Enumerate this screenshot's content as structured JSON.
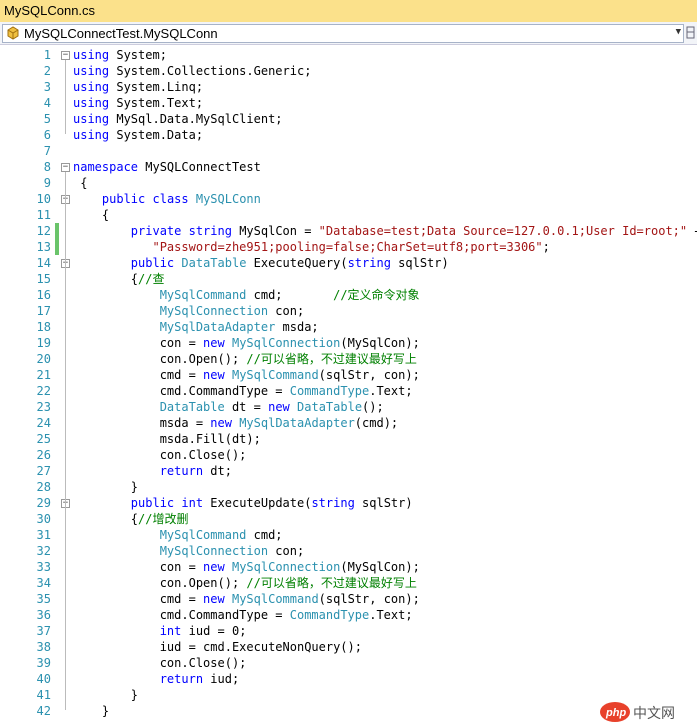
{
  "tab": {
    "title": "MySQLConn.cs"
  },
  "nav": {
    "member": "MySQLConnectTest.MySQLConn"
  },
  "watermark": {
    "text": "php 中文网"
  },
  "colors": {
    "keyword": "#0000ff",
    "type": "#2b91af",
    "string": "#a31515",
    "comment": "#008000"
  },
  "lines": [
    {
      "n": "1",
      "tokens": [
        [
          "k",
          "using"
        ],
        [
          "p",
          " System;"
        ]
      ]
    },
    {
      "n": "2",
      "tokens": [
        [
          "k",
          "using"
        ],
        [
          "p",
          " System.Collections.Generic;"
        ]
      ]
    },
    {
      "n": "3",
      "tokens": [
        [
          "k",
          "using"
        ],
        [
          "p",
          " System.Linq;"
        ]
      ]
    },
    {
      "n": "4",
      "tokens": [
        [
          "k",
          "using"
        ],
        [
          "p",
          " System.Text;"
        ]
      ]
    },
    {
      "n": "5",
      "tokens": [
        [
          "k",
          "using"
        ],
        [
          "p",
          " MySql.Data.MySqlClient;"
        ]
      ]
    },
    {
      "n": "6",
      "tokens": [
        [
          "k",
          "using"
        ],
        [
          "p",
          " System.Data;"
        ]
      ]
    },
    {
      "n": "7",
      "tokens": []
    },
    {
      "n": "8",
      "tokens": [
        [
          "k",
          "namespace"
        ],
        [
          "p",
          " MySQLConnectTest"
        ]
      ]
    },
    {
      "n": "9",
      "tokens": [
        [
          "p",
          " {"
        ]
      ]
    },
    {
      "n": "10",
      "tokens": [
        [
          "p",
          "    "
        ],
        [
          "k",
          "public"
        ],
        [
          "p",
          " "
        ],
        [
          "k",
          "class"
        ],
        [
          "p",
          " "
        ],
        [
          "t",
          "MySQLConn"
        ]
      ]
    },
    {
      "n": "11",
      "tokens": [
        [
          "p",
          "    {"
        ]
      ]
    },
    {
      "n": "12",
      "tokens": [
        [
          "p",
          "        "
        ],
        [
          "k",
          "private"
        ],
        [
          "p",
          " "
        ],
        [
          "k",
          "string"
        ],
        [
          "p",
          " MySqlCon = "
        ],
        [
          "s",
          "\"Database=test;Data Source=127.0.0.1;User Id=root;\""
        ],
        [
          "p",
          " +"
        ]
      ]
    },
    {
      "n": "13",
      "tokens": [
        [
          "p",
          "           "
        ],
        [
          "s",
          "\"Password=zhe951;pooling=false;CharSet=utf8;port=3306\""
        ],
        [
          "p",
          ";"
        ]
      ]
    },
    {
      "n": "14",
      "tokens": [
        [
          "p",
          "        "
        ],
        [
          "k",
          "public"
        ],
        [
          "p",
          " "
        ],
        [
          "t",
          "DataTable"
        ],
        [
          "p",
          " ExecuteQuery("
        ],
        [
          "k",
          "string"
        ],
        [
          "p",
          " sqlStr)"
        ]
      ]
    },
    {
      "n": "15",
      "tokens": [
        [
          "p",
          "        {"
        ],
        [
          "c",
          "//查"
        ]
      ]
    },
    {
      "n": "16",
      "tokens": [
        [
          "p",
          "            "
        ],
        [
          "t",
          "MySqlCommand"
        ],
        [
          "p",
          " cmd;       "
        ],
        [
          "c",
          "//定义命令对象"
        ]
      ]
    },
    {
      "n": "17",
      "tokens": [
        [
          "p",
          "            "
        ],
        [
          "t",
          "MySqlConnection"
        ],
        [
          "p",
          " con;"
        ]
      ]
    },
    {
      "n": "18",
      "tokens": [
        [
          "p",
          "            "
        ],
        [
          "t",
          "MySqlDataAdapter"
        ],
        [
          "p",
          " msda;"
        ]
      ]
    },
    {
      "n": "19",
      "tokens": [
        [
          "p",
          "            con = "
        ],
        [
          "k",
          "new"
        ],
        [
          "p",
          " "
        ],
        [
          "t",
          "MySqlConnection"
        ],
        [
          "p",
          "(MySqlCon);"
        ]
      ]
    },
    {
      "n": "20",
      "tokens": [
        [
          "p",
          "            con.Open(); "
        ],
        [
          "c",
          "//可以省略，不过建议最好写上"
        ]
      ]
    },
    {
      "n": "21",
      "tokens": [
        [
          "p",
          "            cmd = "
        ],
        [
          "k",
          "new"
        ],
        [
          "p",
          " "
        ],
        [
          "t",
          "MySqlCommand"
        ],
        [
          "p",
          "(sqlStr, con);"
        ]
      ]
    },
    {
      "n": "22",
      "tokens": [
        [
          "p",
          "            cmd.CommandType = "
        ],
        [
          "t",
          "CommandType"
        ],
        [
          "p",
          ".Text;"
        ]
      ]
    },
    {
      "n": "23",
      "tokens": [
        [
          "p",
          "            "
        ],
        [
          "t",
          "DataTable"
        ],
        [
          "p",
          " dt = "
        ],
        [
          "k",
          "new"
        ],
        [
          "p",
          " "
        ],
        [
          "t",
          "DataTable"
        ],
        [
          "p",
          "();"
        ]
      ]
    },
    {
      "n": "24",
      "tokens": [
        [
          "p",
          "            msda = "
        ],
        [
          "k",
          "new"
        ],
        [
          "p",
          " "
        ],
        [
          "t",
          "MySqlDataAdapter"
        ],
        [
          "p",
          "(cmd);"
        ]
      ]
    },
    {
      "n": "25",
      "tokens": [
        [
          "p",
          "            msda.Fill(dt);"
        ]
      ]
    },
    {
      "n": "26",
      "tokens": [
        [
          "p",
          "            con.Close();"
        ]
      ]
    },
    {
      "n": "27",
      "tokens": [
        [
          "p",
          "            "
        ],
        [
          "k",
          "return"
        ],
        [
          "p",
          " dt;"
        ]
      ]
    },
    {
      "n": "28",
      "tokens": [
        [
          "p",
          "        }"
        ]
      ]
    },
    {
      "n": "29",
      "tokens": [
        [
          "p",
          "        "
        ],
        [
          "k",
          "public"
        ],
        [
          "p",
          " "
        ],
        [
          "k",
          "int"
        ],
        [
          "p",
          " ExecuteUpdate("
        ],
        [
          "k",
          "string"
        ],
        [
          "p",
          " sqlStr)"
        ]
      ]
    },
    {
      "n": "30",
      "tokens": [
        [
          "p",
          "        {"
        ],
        [
          "c",
          "//增改删"
        ]
      ]
    },
    {
      "n": "31",
      "tokens": [
        [
          "p",
          "            "
        ],
        [
          "t",
          "MySqlCommand"
        ],
        [
          "p",
          " cmd;"
        ]
      ]
    },
    {
      "n": "32",
      "tokens": [
        [
          "p",
          "            "
        ],
        [
          "t",
          "MySqlConnection"
        ],
        [
          "p",
          " con;"
        ]
      ]
    },
    {
      "n": "33",
      "tokens": [
        [
          "p",
          "            con = "
        ],
        [
          "k",
          "new"
        ],
        [
          "p",
          " "
        ],
        [
          "t",
          "MySqlConnection"
        ],
        [
          "p",
          "(MySqlCon);"
        ]
      ]
    },
    {
      "n": "34",
      "tokens": [
        [
          "p",
          "            con.Open(); "
        ],
        [
          "c",
          "//可以省略，不过建议最好写上"
        ]
      ]
    },
    {
      "n": "35",
      "tokens": [
        [
          "p",
          "            cmd = "
        ],
        [
          "k",
          "new"
        ],
        [
          "p",
          " "
        ],
        [
          "t",
          "MySqlCommand"
        ],
        [
          "p",
          "(sqlStr, con);"
        ]
      ]
    },
    {
      "n": "36",
      "tokens": [
        [
          "p",
          "            cmd.CommandType = "
        ],
        [
          "t",
          "CommandType"
        ],
        [
          "p",
          ".Text;"
        ]
      ]
    },
    {
      "n": "37",
      "tokens": [
        [
          "p",
          "            "
        ],
        [
          "k",
          "int"
        ],
        [
          "p",
          " iud = 0;"
        ]
      ]
    },
    {
      "n": "38",
      "tokens": [
        [
          "p",
          "            iud = cmd.ExecuteNonQuery();"
        ]
      ]
    },
    {
      "n": "39",
      "tokens": [
        [
          "p",
          "            con.Close();"
        ]
      ]
    },
    {
      "n": "40",
      "tokens": [
        [
          "p",
          "            "
        ],
        [
          "k",
          "return"
        ],
        [
          "p",
          " iud;"
        ]
      ]
    },
    {
      "n": "41",
      "tokens": [
        [
          "p",
          "        }"
        ]
      ]
    },
    {
      "n": "42",
      "tokens": [
        [
          "p",
          "    }"
        ]
      ]
    }
  ],
  "changed_lines": [
    "12",
    "13"
  ],
  "fold_lines": [
    "1",
    "8",
    "10",
    "14",
    "29"
  ]
}
